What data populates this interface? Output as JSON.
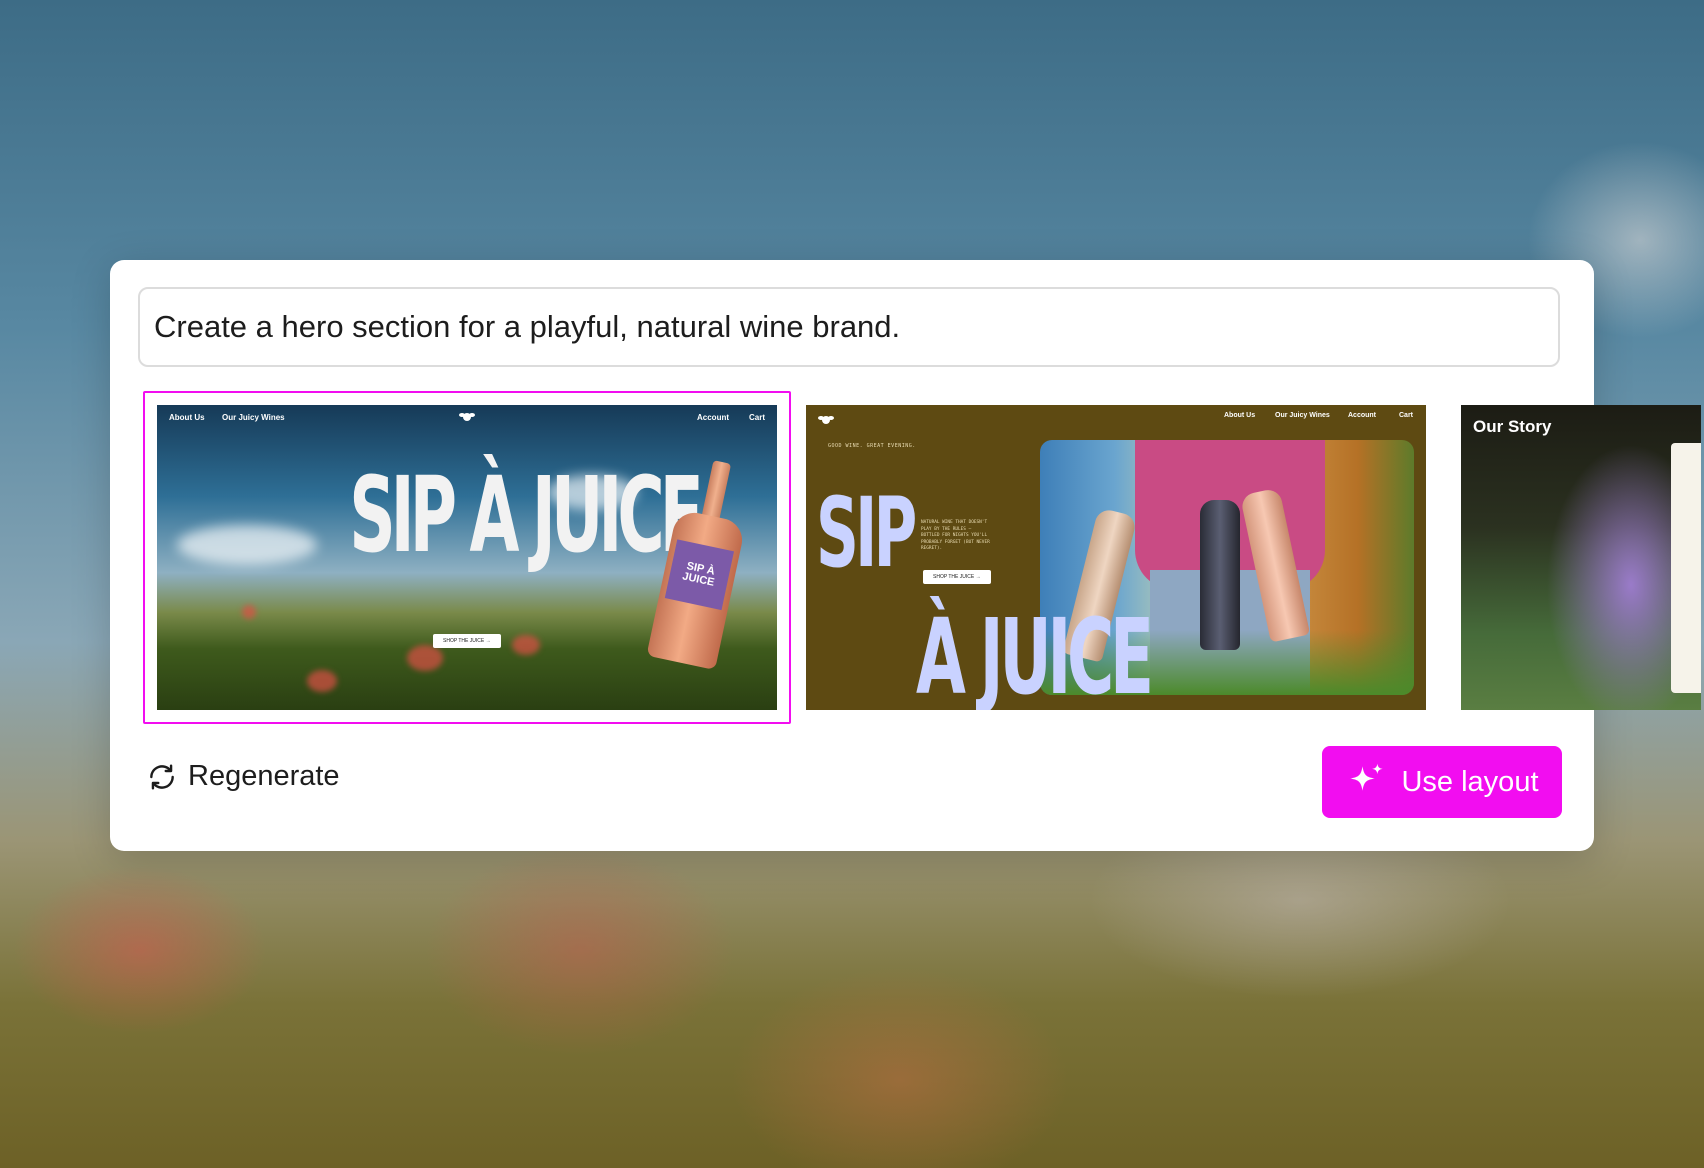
{
  "prompt": {
    "value": "Create a hero section for a playful, natural wine brand."
  },
  "layouts": [
    {
      "nav": {
        "about": "About Us",
        "wines": "Our Juicy Wines",
        "account": "Account",
        "cart": "Cart"
      },
      "headline": "SIP À JUICE",
      "button": "SHOP THE JUICE →",
      "bottle_label": "SIP À JUICE",
      "selected": true
    },
    {
      "nav": {
        "about": "About Us",
        "wines": "Our Juicy Wines",
        "account": "Account",
        "cart": "Cart"
      },
      "tagline": "GOOD WINE. GREAT EVENING.",
      "description": "NATURAL WINE THAT DOESN'T PLAY BY THE RULES — BOTTLED FOR NIGHTS YOU'LL PROBABLY FORGET (BUT NEVER REGRET).",
      "button": "SHOP THE JUICE →",
      "headline_top": "SIP",
      "headline_bottom": "À JUICE"
    },
    {
      "title": "Our Story"
    }
  ],
  "actions": {
    "regenerate": "Regenerate",
    "use_layout": "Use layout"
  },
  "colors": {
    "accent": "#f20df0"
  }
}
